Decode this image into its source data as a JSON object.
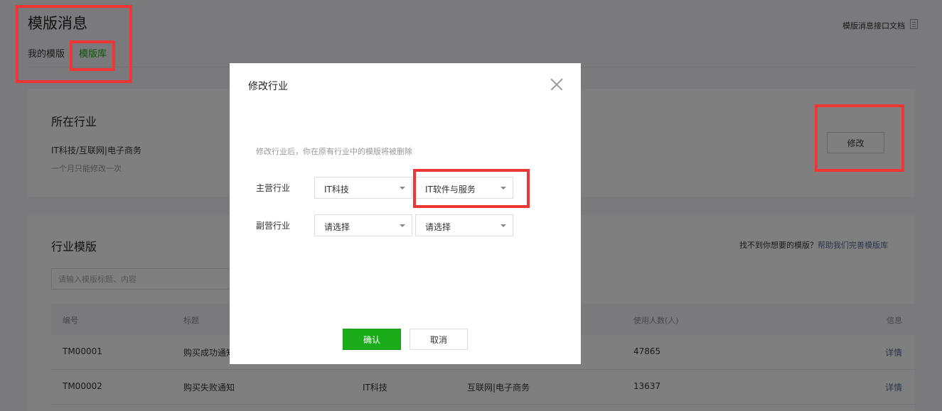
{
  "header": {
    "title": "模版消息",
    "tabs": [
      {
        "label": "我的模版"
      },
      {
        "label": "模版库"
      }
    ],
    "doc_link": "模版消息接口文档",
    "doc_icon": "document-icon"
  },
  "industry_card": {
    "heading": "所在行业",
    "value": "IT科技/互联网|电子商务",
    "note": "一个月只能修改一次",
    "modify_label": "修改"
  },
  "templates_card": {
    "heading": "行业模版",
    "help_text": "找不到你想要的模版？",
    "help_link": "帮助我们完善模版库",
    "search_placeholder": "请输入模版标题、内容",
    "columns": [
      "编号",
      "标题",
      "使用人数(人)",
      "信息"
    ],
    "rows": [
      {
        "id": "TM00001",
        "title": "购买成功通知",
        "industry": "",
        "sub_industry": "",
        "users": "47865",
        "action": "详情"
      },
      {
        "id": "TM00002",
        "title": "购买失败通知",
        "industry": "IT科技",
        "sub_industry": "互联网|电子商务",
        "users": "13637",
        "action": "详情"
      }
    ]
  },
  "dialog": {
    "title": "修改行业",
    "warning": "修改行业后，你在原有行业中的模版将被删除",
    "primary_label": "主营行业",
    "primary_values": [
      "IT科技",
      "IT软件与服务"
    ],
    "secondary_label": "副营行业",
    "secondary_values": [
      "请选择",
      "请选择"
    ],
    "confirm_label": "确认",
    "cancel_label": "取消"
  },
  "colors": {
    "accent": "#1aad19",
    "link": "#576b95",
    "annotation": "#ef3535"
  }
}
